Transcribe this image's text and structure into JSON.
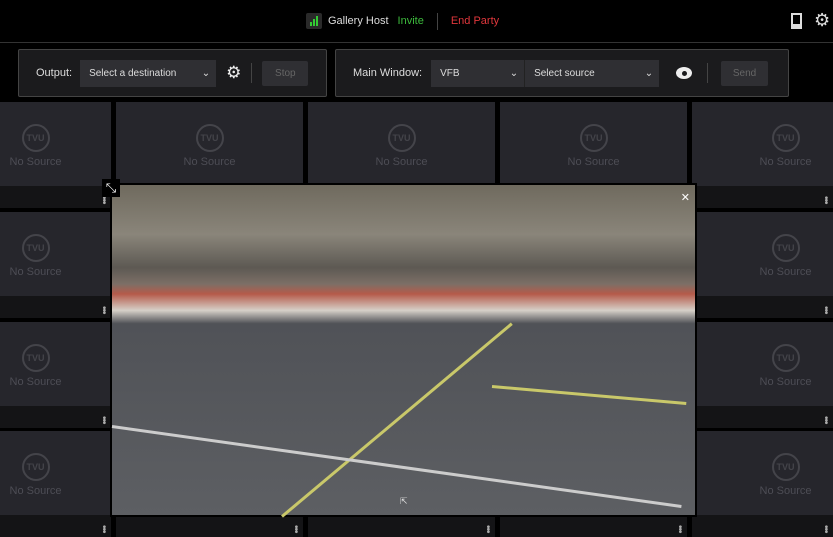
{
  "header": {
    "host_label": "Gallery Host",
    "invite": "Invite",
    "end_party": "End Party",
    "icons": [
      "signal-icon",
      "phone-icon",
      "gear-icon"
    ]
  },
  "output": {
    "label": "Output:",
    "destination": "Select a destination",
    "stop": "Stop"
  },
  "main_window": {
    "label": "Main Window:",
    "mode": "VFB",
    "source": "Select source",
    "send": "Send"
  },
  "tiles": {
    "logo": "TVU",
    "no_source": "No Source"
  },
  "colors": {
    "invite": "#3dbb3d",
    "end_party": "#e0373c",
    "tile": "#26262c"
  }
}
